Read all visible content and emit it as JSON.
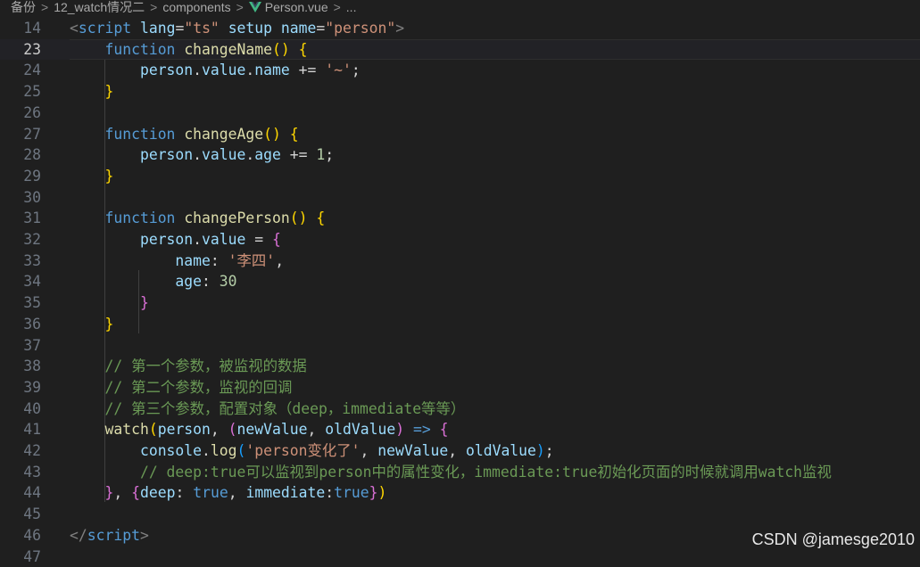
{
  "breadcrumb": {
    "items": [
      "备份",
      "12_watch情况二",
      "components",
      "Person.vue",
      "..."
    ],
    "separator": ">"
  },
  "editor": {
    "lines": [
      {
        "no": "14",
        "tokens": [
          [
            "tag",
            "<"
          ],
          [
            "tagname",
            "script"
          ],
          [
            "op",
            " "
          ],
          [
            "attr",
            "lang"
          ],
          [
            "op",
            "="
          ],
          [
            "str",
            "\"ts\""
          ],
          [
            "op",
            " "
          ],
          [
            "attr",
            "setup"
          ],
          [
            "op",
            " "
          ],
          [
            "attr",
            "name"
          ],
          [
            "op",
            "="
          ],
          [
            "str",
            "\"person\""
          ],
          [
            "tag",
            ">"
          ]
        ]
      },
      {
        "no": "23",
        "active": true,
        "tokens": [
          [
            "op",
            "    "
          ],
          [
            "kw",
            "function"
          ],
          [
            "op",
            " "
          ],
          [
            "fn",
            "changeName"
          ],
          [
            "b1",
            "()"
          ],
          [
            "op",
            " "
          ],
          [
            "b1",
            "{"
          ]
        ]
      },
      {
        "no": "24",
        "tokens": [
          [
            "op",
            "        "
          ],
          [
            "var",
            "person"
          ],
          [
            "op",
            "."
          ],
          [
            "var",
            "value"
          ],
          [
            "op",
            "."
          ],
          [
            "var",
            "name"
          ],
          [
            "op",
            " += "
          ],
          [
            "str",
            "'~'"
          ],
          [
            "op",
            ";"
          ]
        ]
      },
      {
        "no": "25",
        "tokens": [
          [
            "op",
            "    "
          ],
          [
            "b1",
            "}"
          ]
        ]
      },
      {
        "no": "26",
        "tokens": []
      },
      {
        "no": "27",
        "tokens": [
          [
            "op",
            "    "
          ],
          [
            "kw",
            "function"
          ],
          [
            "op",
            " "
          ],
          [
            "fn",
            "changeAge"
          ],
          [
            "b1",
            "()"
          ],
          [
            "op",
            " "
          ],
          [
            "b1",
            "{"
          ]
        ]
      },
      {
        "no": "28",
        "tokens": [
          [
            "op",
            "        "
          ],
          [
            "var",
            "person"
          ],
          [
            "op",
            "."
          ],
          [
            "var",
            "value"
          ],
          [
            "op",
            "."
          ],
          [
            "var",
            "age"
          ],
          [
            "op",
            " += "
          ],
          [
            "num",
            "1"
          ],
          [
            "op",
            ";"
          ]
        ]
      },
      {
        "no": "29",
        "tokens": [
          [
            "op",
            "    "
          ],
          [
            "b1",
            "}"
          ]
        ]
      },
      {
        "no": "30",
        "tokens": []
      },
      {
        "no": "31",
        "tokens": [
          [
            "op",
            "    "
          ],
          [
            "kw",
            "function"
          ],
          [
            "op",
            " "
          ],
          [
            "fn",
            "changePerson"
          ],
          [
            "b1",
            "()"
          ],
          [
            "op",
            " "
          ],
          [
            "b1",
            "{"
          ]
        ]
      },
      {
        "no": "32",
        "tokens": [
          [
            "op",
            "        "
          ],
          [
            "var",
            "person"
          ],
          [
            "op",
            "."
          ],
          [
            "var",
            "value"
          ],
          [
            "op",
            " = "
          ],
          [
            "b2",
            "{"
          ]
        ]
      },
      {
        "no": "33",
        "tokens": [
          [
            "op",
            "            "
          ],
          [
            "var",
            "name"
          ],
          [
            "op",
            ": "
          ],
          [
            "str",
            "'李四'"
          ],
          [
            "op",
            ","
          ]
        ]
      },
      {
        "no": "34",
        "tokens": [
          [
            "op",
            "            "
          ],
          [
            "var",
            "age"
          ],
          [
            "op",
            ": "
          ],
          [
            "num",
            "30"
          ]
        ]
      },
      {
        "no": "35",
        "tokens": [
          [
            "op",
            "        "
          ],
          [
            "b2",
            "}"
          ]
        ]
      },
      {
        "no": "36",
        "tokens": [
          [
            "op",
            "    "
          ],
          [
            "b1",
            "}"
          ]
        ]
      },
      {
        "no": "37",
        "tokens": []
      },
      {
        "no": "38",
        "tokens": [
          [
            "op",
            "    "
          ],
          [
            "cmt",
            "// 第一个参数，被监视的数据"
          ]
        ]
      },
      {
        "no": "39",
        "tokens": [
          [
            "op",
            "    "
          ],
          [
            "cmt",
            "// 第二个参数，监视的回调"
          ]
        ]
      },
      {
        "no": "40",
        "tokens": [
          [
            "op",
            "    "
          ],
          [
            "cmt",
            "// 第三个参数，配置对象（deep，immediate等等）"
          ]
        ]
      },
      {
        "no": "41",
        "tokens": [
          [
            "op",
            "    "
          ],
          [
            "fn",
            "watch"
          ],
          [
            "b1",
            "("
          ],
          [
            "var",
            "person"
          ],
          [
            "op",
            ", "
          ],
          [
            "b2",
            "("
          ],
          [
            "var",
            "newValue"
          ],
          [
            "op",
            ", "
          ],
          [
            "var",
            "oldValue"
          ],
          [
            "b2",
            ")"
          ],
          [
            "op",
            " "
          ],
          [
            "kw",
            "=>"
          ],
          [
            "op",
            " "
          ],
          [
            "b2",
            "{"
          ]
        ]
      },
      {
        "no": "42",
        "tokens": [
          [
            "op",
            "        "
          ],
          [
            "var",
            "console"
          ],
          [
            "op",
            "."
          ],
          [
            "fn",
            "log"
          ],
          [
            "b3",
            "("
          ],
          [
            "str",
            "'person变化了'"
          ],
          [
            "op",
            ", "
          ],
          [
            "var",
            "newValue"
          ],
          [
            "op",
            ", "
          ],
          [
            "var",
            "oldValue"
          ],
          [
            "b3",
            ")"
          ],
          [
            "op",
            ";"
          ]
        ]
      },
      {
        "no": "43",
        "tokens": [
          [
            "op",
            "        "
          ],
          [
            "cmt",
            "// deep:true可以监视到person中的属性变化，immediate:true初始化页面的时候就调用watch监视"
          ]
        ]
      },
      {
        "no": "44",
        "tokens": [
          [
            "op",
            "    "
          ],
          [
            "b2",
            "}"
          ],
          [
            "op",
            ", "
          ],
          [
            "b2",
            "{"
          ],
          [
            "var",
            "deep"
          ],
          [
            "op",
            ": "
          ],
          [
            "kw",
            "true"
          ],
          [
            "op",
            ", "
          ],
          [
            "var",
            "immediate"
          ],
          [
            "op",
            ":"
          ],
          [
            "kw",
            "true"
          ],
          [
            "b2",
            "}"
          ],
          [
            "b1",
            ")"
          ]
        ]
      },
      {
        "no": "45",
        "tokens": []
      },
      {
        "no": "46",
        "tokens": [
          [
            "tag",
            "</"
          ],
          [
            "tagname",
            "script"
          ],
          [
            "tag",
            ">"
          ]
        ]
      },
      {
        "no": "47",
        "tokens": []
      }
    ]
  },
  "watermark": "CSDN @jamesge2010"
}
